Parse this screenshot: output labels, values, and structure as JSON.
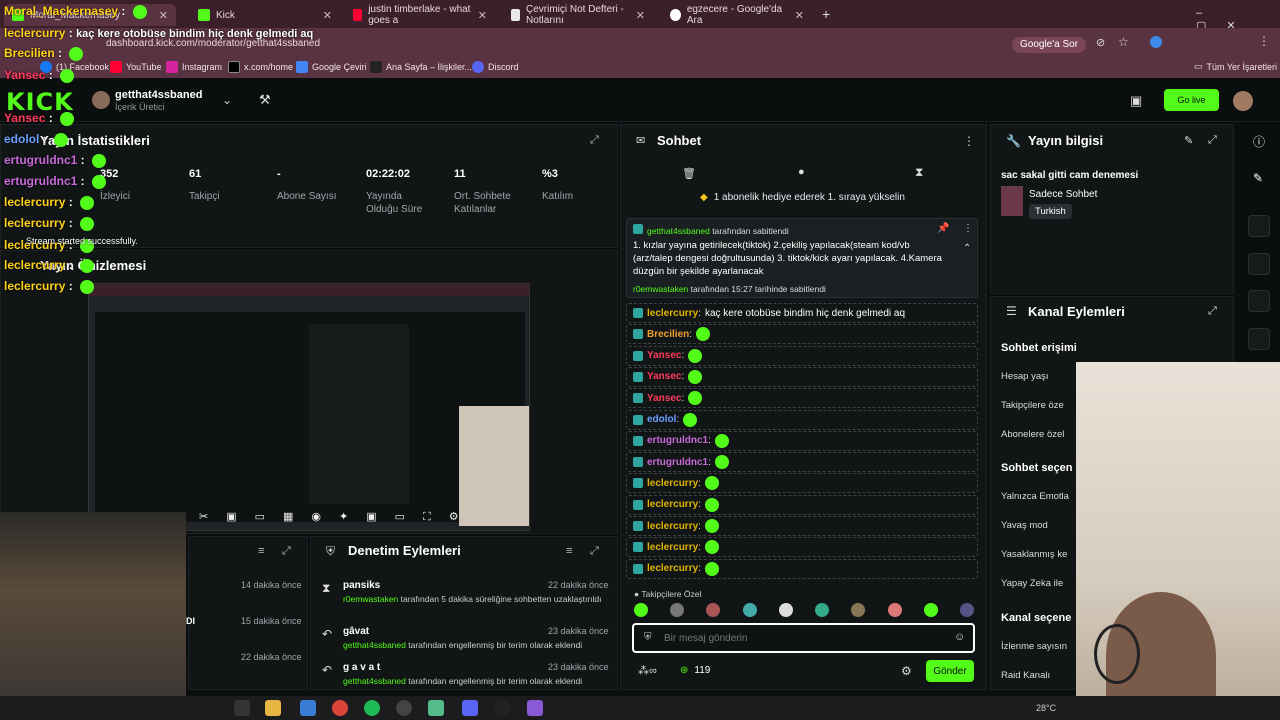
{
  "browser": {
    "tabs": [
      {
        "label": "Moral_Mackernasey"
      },
      {
        "label": "Kick"
      },
      {
        "label": "justin timberlake - what goes a"
      },
      {
        "label": "Çevrimiçi Not Defteri - Notlarını"
      },
      {
        "label": "egzecere - Google'da Ara"
      }
    ],
    "url": "dashboard.kick.com/moderator/getthat4ssbaned",
    "google_sor": "Google'a Sor",
    "bookmarks": [
      "(1) Facebook",
      "YouTube",
      "Instagram",
      "x.com/home",
      "Google Çeviri",
      "Ana Sayfa – İlişkiler...",
      "Discord"
    ],
    "all_bookmarks": "Tüm Yer İşaretleri"
  },
  "kick": {
    "logo": "KICK",
    "channel_name": "getthat4ssbaned",
    "channel_role": "İçerik Üretici",
    "go_live": "Go live"
  },
  "stats": {
    "title": "Yayın İstatistikleri",
    "items": [
      {
        "value": "352",
        "label": "İzleyici"
      },
      {
        "value": "61",
        "label": "Takipçi"
      },
      {
        "value": "-",
        "label": "Abone Sayısı"
      },
      {
        "value": "02:22:02",
        "label": "Yayında Olduğu Süre"
      },
      {
        "value": "11",
        "label": "Ort. Sohbete Katılanlar"
      },
      {
        "value": "%3",
        "label": "Katılım"
      }
    ]
  },
  "preview": {
    "title": "Yayın Önizlemesi"
  },
  "recent": {
    "times": [
      "14 dakika önce",
      "15 dakika önce",
      "22 dakika önce"
    ],
    "partial": "DI"
  },
  "mod_actions": {
    "title": "Denetim Eylemleri",
    "items": [
      {
        "user": "pansiks",
        "time": "22 dakika önce",
        "actor": "r0emwastaken",
        "text": "tarafından 5 dakika süreliğine sohbetten uzaklaştırıldı"
      },
      {
        "user": "gâvat",
        "time": "23 dakika önce",
        "actor": "getthat4ssbaned",
        "text": "tarafından engellenmiş bir terim olarak eklendi"
      },
      {
        "user": "g a v a t",
        "time": "23 dakika önce",
        "actor": "getthat4ssbaned",
        "text": "tarafından engellenmiş bir terim olarak eklendi"
      }
    ]
  },
  "chat": {
    "title": "Sohbet",
    "gift_banner": "1 abonelik hediye ederek 1. sıraya yükselin",
    "pinned": {
      "author": "getthat4ssbaned",
      "author_suffix": "tarafından sabitlendi",
      "text": "1. kızlar yayına getirilecek(tiktok) 2.çekiliş yapılacak(steam kod/vb (arz/talep dengesi doğrultusunda) 3. tiktok/kick ayarı yapılacak. 4.Kamera düzgün bir şekilde ayarlanacak",
      "pinned_by": "r0emwastaken",
      "pinned_at": "tarafından 15:27 tarihinde sabitlendi"
    },
    "messages": [
      {
        "user": "leclercurry",
        "color": "#e0b400",
        "text": "kaç kere otobüse bindim hiç denk gelmedi aq"
      },
      {
        "user": "Brecilien",
        "color": "#f0a030",
        "text": ""
      },
      {
        "user": "Yansec",
        "color": "#ff3b5c",
        "text": ""
      },
      {
        "user": "Yansec",
        "color": "#ff3b5c",
        "text": ""
      },
      {
        "user": "Yansec",
        "color": "#ff3b5c",
        "text": ""
      },
      {
        "user": "edolol",
        "color": "#6aa0ff",
        "text": ""
      },
      {
        "user": "ertugruldnc1",
        "color": "#c86ad8",
        "text": ""
      },
      {
        "user": "ertugruldnc1",
        "color": "#c86ad8",
        "text": ""
      },
      {
        "user": "leclercurry",
        "color": "#e0b400",
        "text": ""
      },
      {
        "user": "leclercurry",
        "color": "#e0b400",
        "text": ""
      },
      {
        "user": "leclercurry",
        "color": "#e0b400",
        "text": ""
      },
      {
        "user": "leclercurry",
        "color": "#e0b400",
        "text": ""
      },
      {
        "user": "leclercurry",
        "color": "#e0b400",
        "text": ""
      }
    ],
    "followers_only": "Takipçilere Özel",
    "input_placeholder": "Bir mesaj gönderin",
    "infinity": "∞",
    "points": "119",
    "send": "Gönder"
  },
  "stream_info": {
    "title": "Yayın bilgisi",
    "stream_title": "sac sakal gitti cam denemesi",
    "category": "Sadece Sohbet",
    "language": "Turkish"
  },
  "channel_actions": {
    "title": "Kanal Eylemleri",
    "sections": [
      {
        "heading": "Sohbet erişimi",
        "items": [
          "Hesap yaşı",
          "Takipçilere öze",
          "Abonelere özel"
        ]
      },
      {
        "heading": "Sohbet seçen",
        "items": [
          "Yalnızca Emotla",
          "Yavaş mod",
          "Yasaklanmış ke",
          "Yapay Zeka ile"
        ]
      },
      {
        "heading": "Kanal seçene",
        "items": [
          "İzlenme sayısın",
          "Raid Kanalı"
        ]
      }
    ]
  },
  "overlay_chat": [
    {
      "user": "Moral_Mackernasey",
      "color": "#ffd21a",
      "text": ""
    },
    {
      "user": "leclercurry",
      "color": "#ffd21a",
      "text": "kaç kere otobüse bindim hiç denk gelmedi aq"
    },
    {
      "user": "Brecilien",
      "color": "#ffd21a",
      "text": ""
    },
    {
      "user": "Yansec",
      "color": "#ff3b5c",
      "text": ""
    },
    {
      "user": "Yansec",
      "color": "#ff3b5c",
      "text": ""
    },
    {
      "user": "edolol",
      "color": "#6aa0ff",
      "text": ""
    },
    {
      "user": "ertugruldnc1",
      "color": "#c86ad8",
      "text": ""
    },
    {
      "user": "ertugruldnc1",
      "color": "#c86ad8",
      "text": ""
    },
    {
      "user": "leclercurry",
      "color": "#ffd21a",
      "text": ""
    },
    {
      "user": "leclercurry",
      "color": "#ffd21a",
      "text": ""
    },
    {
      "user": "leclercurry",
      "color": "#ffd21a",
      "text": ""
    },
    {
      "user": "leclercurry",
      "color": "#ffd21a",
      "text": ""
    },
    {
      "user": "leclercurry",
      "color": "#ffd21a",
      "text": ""
    }
  ],
  "overlay_notice": "Stream started successfully.",
  "taskbar": {
    "weather": "28°C"
  },
  "colors": {
    "accent": "#53fc18",
    "tabbar": "#3b1f2b",
    "panel": "#111516"
  }
}
